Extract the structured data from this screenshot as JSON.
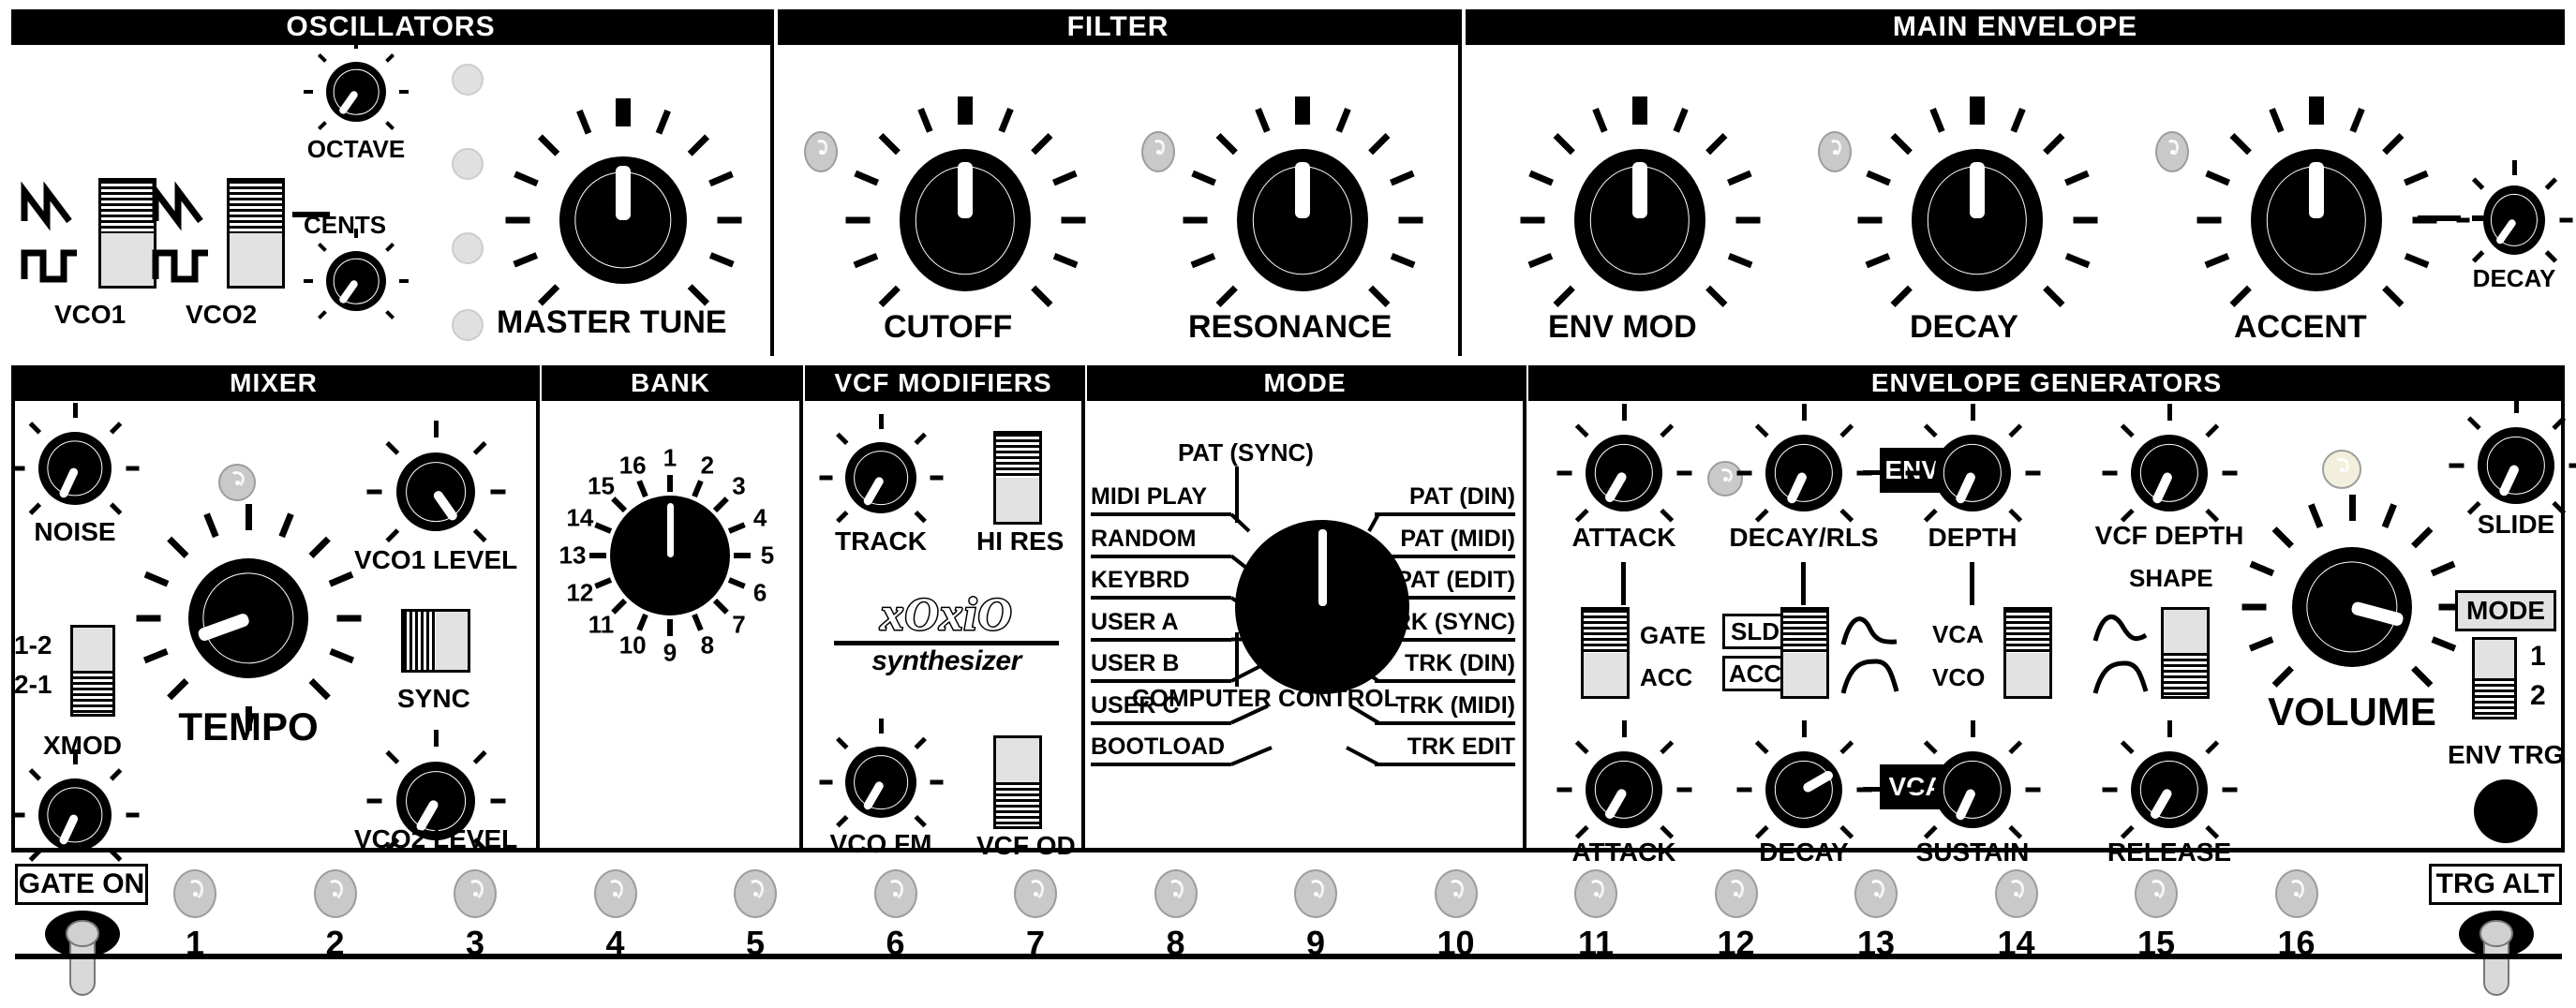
{
  "device": {
    "brand": "xOxiO",
    "sub_brand": "synthesizer"
  },
  "sections": {
    "oscillators": {
      "title": "OSCILLATORS"
    },
    "filter": {
      "title": "FILTER"
    },
    "main_envelope": {
      "title": "MAIN ENVELOPE"
    },
    "mixer": {
      "title": "MIXER"
    },
    "bank": {
      "title": "BANK"
    },
    "vcf_modifiers": {
      "title": "VCF MODIFIERS"
    },
    "mode": {
      "title": "MODE"
    },
    "envelope_generators": {
      "title": "ENVELOPE GENERATORS"
    }
  },
  "oscillators": {
    "octave_label": "OCTAVE",
    "cents_label": "CENTS",
    "master_tune_label": "MASTER TUNE",
    "vco1_label": "VCO1",
    "vco2_label": "VCO2"
  },
  "filter": {
    "cutoff_label": "CUTOFF",
    "resonance_label": "RESONANCE"
  },
  "main_envelope": {
    "env_mod_label": "ENV MOD",
    "decay_label": "DECAY",
    "accent_label": "ACCENT",
    "accent_decay_label": "DECAY"
  },
  "mixer": {
    "noise_label": "NOISE",
    "xmod_label": "XMOD",
    "xmod_up_label": "1-2",
    "xmod_down_label": "2-1",
    "tempo_label": "TEMPO",
    "vco1_level_label": "VCO1 LEVEL",
    "vco2_level_label": "VCO2 LEVEL",
    "sync_label": "SYNC"
  },
  "bank": {
    "positions": [
      "1",
      "2",
      "3",
      "4",
      "5",
      "6",
      "7",
      "8",
      "9",
      "10",
      "11",
      "12",
      "13",
      "14",
      "15",
      "16"
    ],
    "selected": "1"
  },
  "vcf_modifiers": {
    "track_label": "TRACK",
    "hi_res_label": "HI RES",
    "vco_fm_label": "VCO FM",
    "vcf_od_label": "VCF OD"
  },
  "mode": {
    "top_label": "PAT (SYNC)",
    "bottom_label": "COMPUTER CONTROL",
    "left_labels": [
      "MIDI PLAY",
      "RANDOM",
      "KEYBRD",
      "USER A",
      "USER B",
      "USER C",
      "BOOTLOAD"
    ],
    "right_labels": [
      "PAT (DIN)",
      "PAT (MIDI)",
      "PAT (EDIT)",
      "TRK (SYNC)",
      "TRK (DIN)",
      "TRK (MIDI)",
      "TRK EDIT"
    ],
    "selected": "PAT (SYNC)"
  },
  "envelope_generators": {
    "attack1_label": "ATTACK",
    "decay_rls_label": "DECAY/RLS",
    "depth_label": "DEPTH",
    "env2_badge": "ENV2",
    "gate_label": "GATE",
    "acc_label": "ACC",
    "sld_badge": "SLD",
    "acc_badge": "ACC",
    "vca_label": "VCA",
    "vco_label": "VCO",
    "attack2_label": "ATTACK",
    "decay2_label": "DECAY",
    "sustain_label": "SUSTAIN",
    "vca_badge": "VCA",
    "release_label": "RELEASE",
    "vcf_depth_label": "VCF DEPTH",
    "shape_label": "SHAPE",
    "volume_label": "VOLUME",
    "slide_label": "SLIDE",
    "mode_badge": "MODE",
    "mode_1": "1",
    "mode_2": "2",
    "env_trg_label": "ENV TRG"
  },
  "sequencer": {
    "gate_on_label": "GATE ON",
    "trg_alt_label": "TRG ALT",
    "steps": [
      "1",
      "2",
      "3",
      "4",
      "5",
      "6",
      "7",
      "8",
      "9",
      "10",
      "11",
      "12",
      "13",
      "14",
      "15",
      "16"
    ]
  },
  "colors": {
    "panel": "#ffffff",
    "ink": "#000000",
    "led_off": "#e0e0e0",
    "led_gray": "#c9c9c9",
    "led_lit": "#f2f0dc",
    "switch_face": "#e2e2e2"
  }
}
